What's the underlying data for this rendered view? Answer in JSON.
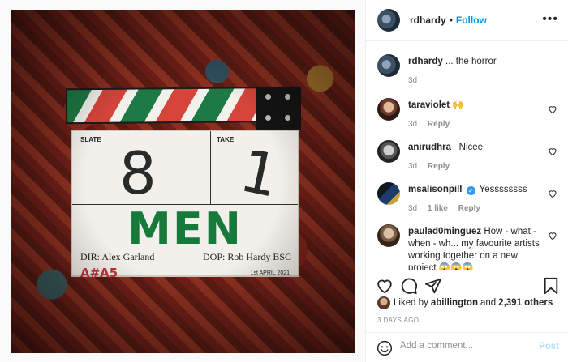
{
  "post_image": {
    "slate_label": "SLATE",
    "take_label": "TAKE",
    "slate_number": "8",
    "take_number": "1",
    "film_title": "MEN",
    "director": "DIR: Alex Garland",
    "dop": "DOP: Rob Hardy BSC",
    "logo_text": "A#A5",
    "date_text": "1st APRIL 2021"
  },
  "header": {
    "username": "rdhardy",
    "dot": "•",
    "follow_label": "Follow",
    "more_label": "•••"
  },
  "caption": {
    "username": "rdhardy",
    "text": "... the horror",
    "time": "3d"
  },
  "comments": [
    {
      "username": "taraviolet",
      "text": "🙌",
      "time": "3d",
      "reply_label": "Reply"
    },
    {
      "username": "anirudhra_",
      "text": "Nicee",
      "time": "3d",
      "reply_label": "Reply"
    },
    {
      "username": "msalisonpill",
      "verified": "✓",
      "text": "Yessssssss",
      "time": "3d",
      "likes": "1 like",
      "reply_label": "Reply"
    },
    {
      "username": "paulad0minguez",
      "text": "How - what - when - wh... my favourite artists working together on a new project 😱😱😱"
    }
  ],
  "likes": {
    "prefix": "Liked by",
    "user": "abillington",
    "conjunction": "and",
    "others": "2,391 others"
  },
  "posted_ago": "3 DAYS AGO",
  "add_comment": {
    "placeholder": "Add a comment...",
    "post_label": "Post"
  },
  "colors": {
    "link_blue": "#0095f6",
    "post_disabled": "#b2dffc",
    "muted": "#8e8e8e",
    "title_green": "#177a3b"
  }
}
